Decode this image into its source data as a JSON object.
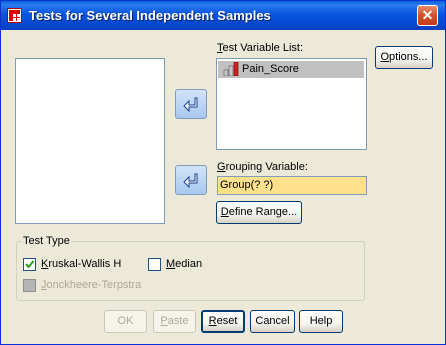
{
  "window": {
    "title": "Tests for Several Independent Samples",
    "close_glyph": "✕"
  },
  "source_list": {
    "items": []
  },
  "test_variable_list": {
    "label_prefix": "T",
    "label_rest": "est Variable List:",
    "items": [
      {
        "label": "Pain_Score",
        "selected": true
      }
    ]
  },
  "grouping_variable": {
    "label_prefix": "G",
    "label_rest": "rouping Variable:",
    "value": "Group(? ?)"
  },
  "buttons": {
    "options": {
      "prefix": "O",
      "rest": "ptions..."
    },
    "define_range": {
      "prefix": "D",
      "rest": "efine Range..."
    },
    "ok": {
      "label": "OK",
      "enabled": false
    },
    "paste": {
      "prefix": "P",
      "rest": "aste",
      "enabled": false
    },
    "reset": {
      "prefix": "R",
      "rest": "eset"
    },
    "cancel": {
      "label": "Cancel"
    },
    "help": {
      "label": "Help"
    }
  },
  "test_type": {
    "legend": "Test Type",
    "kruskal": {
      "prefix": "K",
      "rest": "ruskal-Wallis H",
      "checked": true
    },
    "median": {
      "prefix": "M",
      "rest": "edian",
      "checked": false
    },
    "jonckheere": {
      "prefix": "J",
      "rest": "onckheere-Terpstra",
      "checked": false,
      "enabled": false
    }
  },
  "colors": {
    "title_bar": "#0a55e0",
    "dialog_bg": "#ece9d8",
    "grouping_field_bg": "#ffe08c",
    "selected_item_bg": "#c0c0c0"
  }
}
